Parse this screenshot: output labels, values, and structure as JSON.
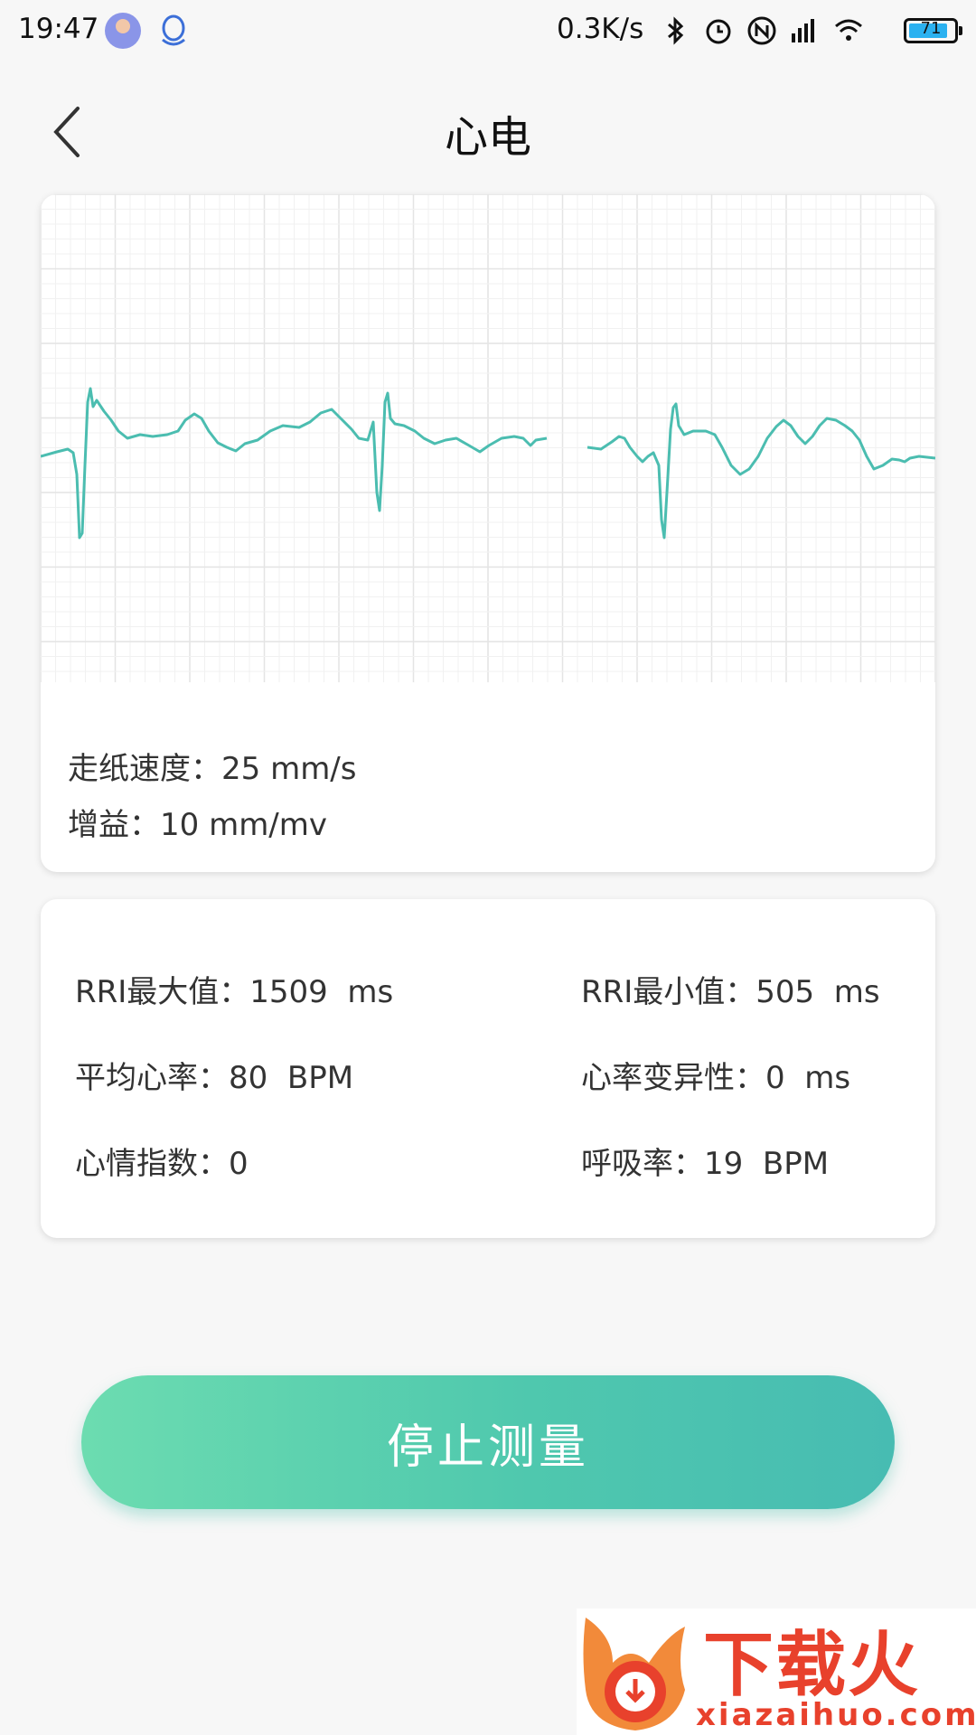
{
  "status_bar": {
    "time": "19:47",
    "net_speed": "0.3K/s",
    "battery_level": "71",
    "icons": [
      "avatar-icon",
      "qq-icon",
      "bluetooth-icon",
      "alarm-icon",
      "nfc-icon",
      "signal-icon",
      "sim-icon",
      "wifi-icon",
      "battery-icon"
    ]
  },
  "header": {
    "title": "心电",
    "back_icon": "chevron-left-icon"
  },
  "ecg": {
    "paper_speed": "走纸速度：25  mm/s",
    "gain": "增益：10  mm/mv",
    "line_color": "#4bbdb0"
  },
  "stats": {
    "rri_max": "RRI最大值：1509  ms",
    "rri_min": "RRI最小值：505  ms",
    "avg_hr": "平均心率：80  BPM",
    "hrv": "心率变异性：0  ms",
    "mood_index": "心情指数：0",
    "resp_rate": "呼吸率：19  BPM"
  },
  "action": {
    "stop_label": "停止测量"
  },
  "watermark": {
    "brand": "下载火",
    "domain": "xiazaihuo.com"
  },
  "colors": {
    "accent_start": "#6cdcb0",
    "accent_end": "#47bcb2",
    "watermark": "#e8412c"
  }
}
